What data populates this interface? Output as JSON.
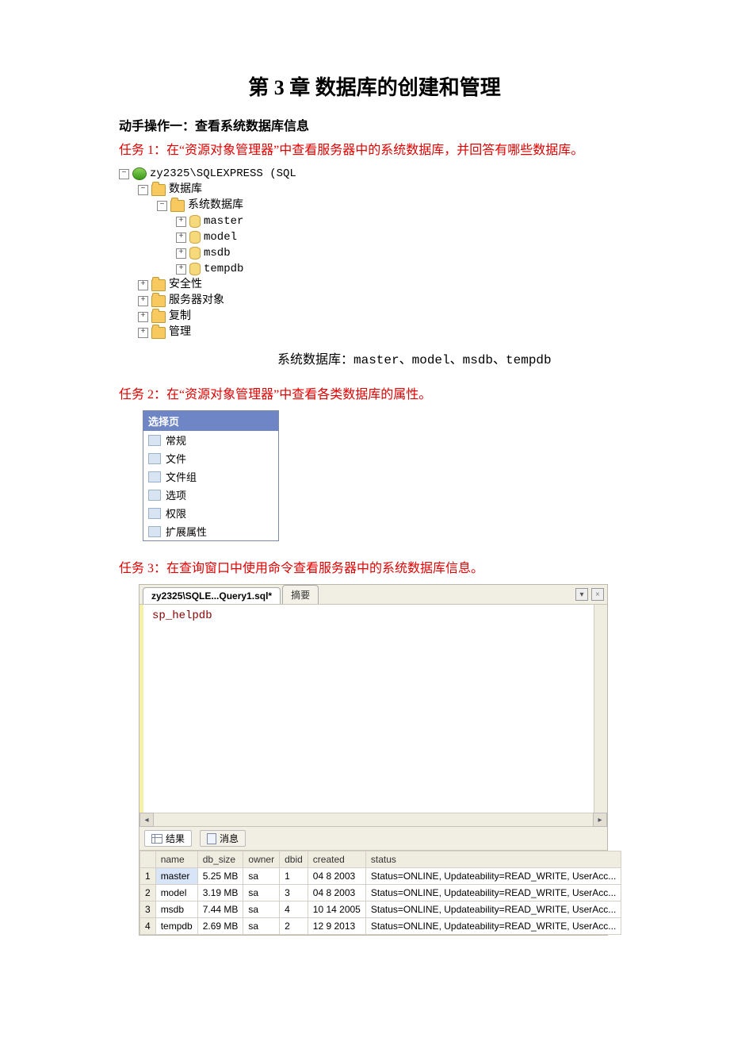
{
  "chapter_title": "第 3 章  数据库的创建和管理",
  "section1": "动手操作一：查看系统数据库信息",
  "task1": "任务 1：在“资源对象管理器”中查看服务器中的系统数据库，并回答有哪些数据库。",
  "task2": "任务 2：在“资源对象管理器”中查看各类数据库的属性。",
  "task3": "任务 3：在查询窗口中使用命令查看服务器中的系统数据库信息。",
  "tree": {
    "server": "zy2325\\SQLEXPRESS (SQL",
    "databases": "数据库",
    "sysdbs": "系统数据库",
    "dbs": [
      "master",
      "model",
      "msdb",
      "tempdb"
    ],
    "folders": [
      "安全性",
      "服务器对象",
      "复制",
      "管理"
    ]
  },
  "caption": "系统数据库：master、model、msdb、tempdb",
  "prop_panel": {
    "header": "选择页",
    "items": [
      "常规",
      "文件",
      "文件组",
      "选项",
      "权限",
      "扩展属性"
    ]
  },
  "editor": {
    "tab_active": "zy2325\\SQLE...Query1.sql*",
    "tab_other": "摘要",
    "code": "sp_helpdb"
  },
  "results": {
    "tab_results": "结果",
    "tab_messages": "消息",
    "columns": [
      "name",
      "db_size",
      "owner",
      "dbid",
      "created",
      "status"
    ],
    "rows": [
      {
        "n": "1",
        "name": "master",
        "db_size": "5.25 MB",
        "owner": "sa",
        "dbid": "1",
        "created": "04  8 2003",
        "status": "Status=ONLINE, Updateability=READ_WRITE, UserAcc..."
      },
      {
        "n": "2",
        "name": "model",
        "db_size": "3.19 MB",
        "owner": "sa",
        "dbid": "3",
        "created": "04  8 2003",
        "status": "Status=ONLINE, Updateability=READ_WRITE, UserAcc..."
      },
      {
        "n": "3",
        "name": "msdb",
        "db_size": "7.44 MB",
        "owner": "sa",
        "dbid": "4",
        "created": "10 14 2005",
        "status": "Status=ONLINE, Updateability=READ_WRITE, UserAcc..."
      },
      {
        "n": "4",
        "name": "tempdb",
        "db_size": "2.69 MB",
        "owner": "sa",
        "dbid": "2",
        "created": "12  9 2013",
        "status": "Status=ONLINE, Updateability=READ_WRITE, UserAcc..."
      }
    ]
  }
}
